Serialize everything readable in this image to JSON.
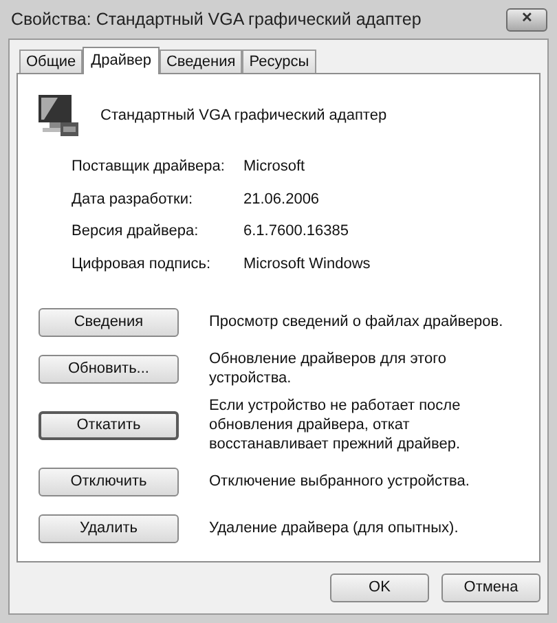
{
  "window": {
    "title": "Свойства: Стандартный VGA графический адаптер",
    "close": "✕"
  },
  "tabs": [
    {
      "label": "Общие",
      "selected": false
    },
    {
      "label": "Драйвер",
      "selected": true
    },
    {
      "label": "Сведения",
      "selected": false
    },
    {
      "label": "Ресурсы",
      "selected": false
    }
  ],
  "device_name": "Стандартный VGA графический адаптер",
  "properties": [
    {
      "label": "Поставщик драйвера:",
      "value": "Microsoft"
    },
    {
      "label": "Дата разработки:",
      "value": "21.06.2006"
    },
    {
      "label": "Версия драйвера:",
      "value": "6.1.7600.16385"
    },
    {
      "label": "Цифровая подпись:",
      "value": "Microsoft Windows"
    }
  ],
  "actions": [
    {
      "button": "Сведения",
      "description": "Просмотр сведений о файлах драйверов.",
      "focused": false
    },
    {
      "button": "Обновить...",
      "description": "Обновление драйверов для этого устройства.",
      "focused": false
    },
    {
      "button": "Откатить",
      "description": "Если устройство не работает после обновления драйвера, откат восстанавливает прежний драйвер.",
      "focused": true
    },
    {
      "button": "Отключить",
      "description": "Отключение выбранного устройства.",
      "focused": false
    },
    {
      "button": "Удалить",
      "description": "Удаление драйвера (для опытных).",
      "focused": false
    }
  ],
  "buttons": [
    "OK",
    "Отмена"
  ]
}
